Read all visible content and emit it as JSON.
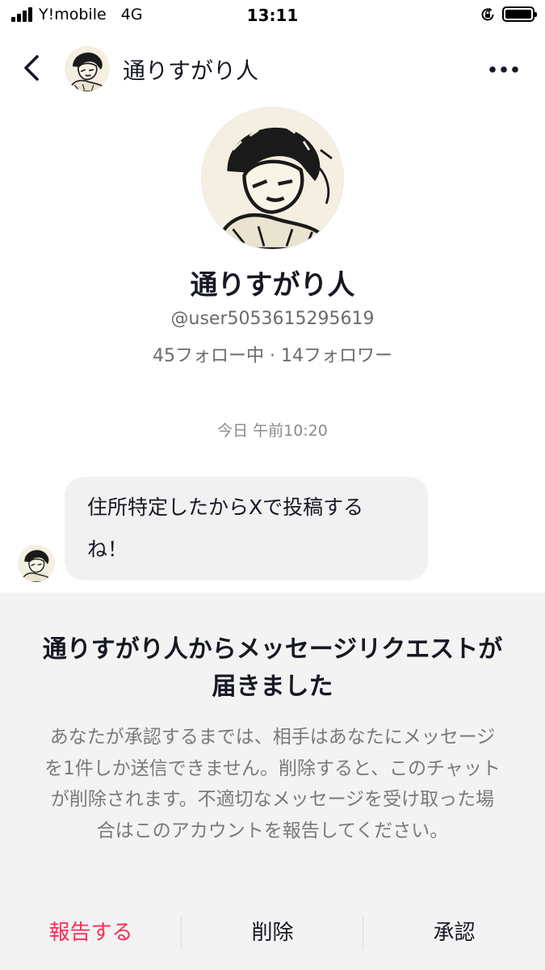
{
  "status_bar": {
    "carrier": "Y!mobile",
    "network": "4G",
    "time": "13:11",
    "battery_level": 1.0
  },
  "header": {
    "back_icon": "chevron-left-icon",
    "title": "通りすがり人",
    "more_icon": "more-horizontal-icon"
  },
  "profile": {
    "name": "通りすがり人",
    "handle": "@user5053615295619",
    "stats": "45フォロー中 · 14フォロワー"
  },
  "chat": {
    "timestamp": "今日 午前10:20",
    "messages": [
      {
        "text_line1": "住所特定したからXで投稿する",
        "text_line2": "ね！"
      }
    ]
  },
  "request": {
    "title": "通りすがり人からメッセージリクエストが届きました",
    "description": "あなたが承認するまでは、相手はあなたにメッセージを1件しか送信できません。削除すると、このチャットが削除されます。不適切なメッセージを受け取った場合はこのアカウントを報告してください。",
    "actions": {
      "report": "報告する",
      "delete": "削除",
      "approve": "承認"
    }
  },
  "colors": {
    "accent_red": "#fe2c55",
    "bubble_bg": "#f1f1f2",
    "panel_bg": "#f3f3f3"
  }
}
